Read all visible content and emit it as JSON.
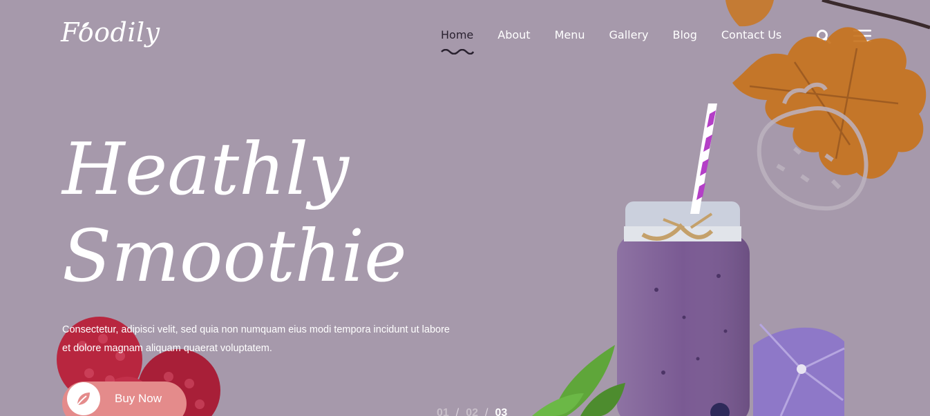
{
  "brand": {
    "logo_text": "Foodily"
  },
  "nav": {
    "items": [
      {
        "label": "Home",
        "active": true
      },
      {
        "label": "About",
        "active": false
      },
      {
        "label": "Menu",
        "active": false
      },
      {
        "label": "Gallery",
        "active": false
      },
      {
        "label": "Blog",
        "active": false
      },
      {
        "label": "Contact Us",
        "active": false
      }
    ],
    "icons": [
      "search-icon",
      "menu-icon"
    ]
  },
  "hero": {
    "title_line1": "Heathly",
    "title_line2": "Smoothie",
    "description": "Consectetur, adipisci velit, sed quia non numquam eius modi tempora incidunt ut labore et dolore magnam aliquam quaerat voluptatem.",
    "button_label": "Buy Now"
  },
  "slider": {
    "slides": [
      "01",
      "02",
      "03"
    ],
    "separator": "/",
    "current": "03"
  },
  "colors": {
    "background": "#a699ab",
    "accent_button": "#e48b8b",
    "active_nav": "#2a2230",
    "text": "#ffffff"
  }
}
